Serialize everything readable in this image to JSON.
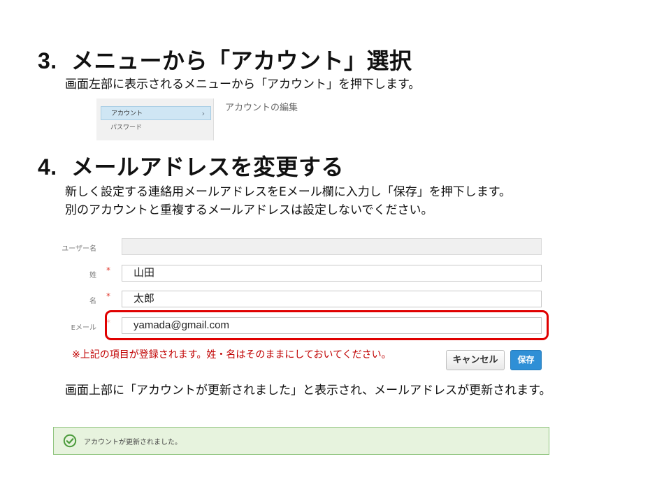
{
  "step3": {
    "number": "3.",
    "title": "メニューから「アカウント」選択",
    "description": "画面左部に表示されるメニューから「アカウント」を押下します。",
    "menu_items": [
      "アカウント",
      "パスワード"
    ],
    "active_chevron": "›",
    "edit_title": "アカウントの編集"
  },
  "step4": {
    "number": "4.",
    "title": "メールアドレスを変更する",
    "description_line1": "新しく設定する連絡用メールアドレスをEメール欄に入力し「保存」を押下します。",
    "description_line2": "別のアカウントと重複するメールアドレスは設定しないでください。",
    "form": {
      "username_label": "ユーザー名",
      "username_value": "",
      "last_name_label": "姓",
      "last_name_value": "山田",
      "first_name_label": "名",
      "first_name_value": "太郎",
      "email_label": "Eメール",
      "email_value": "yamada@gmail.com",
      "required_mark": "*"
    },
    "note": "※上記の項目が登録されます。姓・名はそのままにしておいてください。",
    "cancel_label": "キャンセル",
    "save_label": "保存",
    "result_description": "画面上部に「アカウントが更新されました」と表示され、メールアドレスが更新されます。",
    "success_message": "アカウントが更新されました。"
  },
  "colors": {
    "highlight": "#e00000",
    "note": "#c00000",
    "save_button": "#2f8fd6",
    "success_bg": "#e7f3de",
    "success_icon": "#4a9a3a"
  },
  "icons": {
    "success": "check-circle-icon",
    "menu_chevron": "chevron-right-icon"
  }
}
